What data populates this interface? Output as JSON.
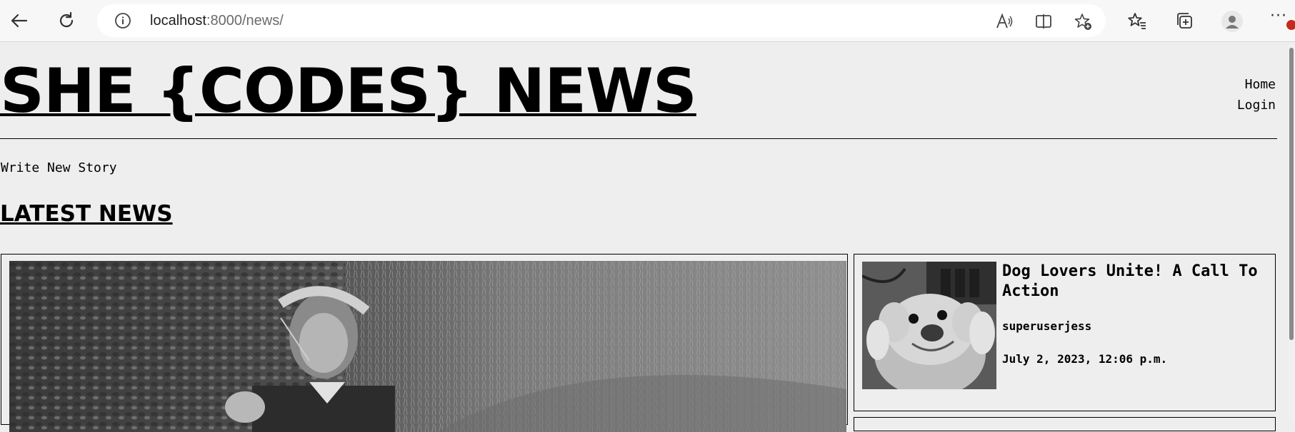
{
  "browser": {
    "url_host": "localhost",
    "url_rest": ":8000/news/",
    "icons": [
      "back-icon",
      "refresh-icon",
      "site-info-icon",
      "read-aloud-icon",
      "split-screen-icon",
      "add-favorite-icon",
      "favorites-icon",
      "collections-icon",
      "profile-icon",
      "more-icon"
    ]
  },
  "site": {
    "title": "SHE {CODES} NEWS",
    "nav": {
      "home": "Home",
      "login": "Login"
    },
    "write_link": "Write New Story",
    "section_heading": "LATEST NEWS"
  },
  "stories": {
    "featured": {
      "image": "black-and-white photo of a man lying in grass"
    },
    "side": [
      {
        "title": "Dog Lovers Unite! A Call To Action",
        "author": "superuserjess",
        "date": "July 2, 2023, 12:06 p.m."
      }
    ]
  }
}
